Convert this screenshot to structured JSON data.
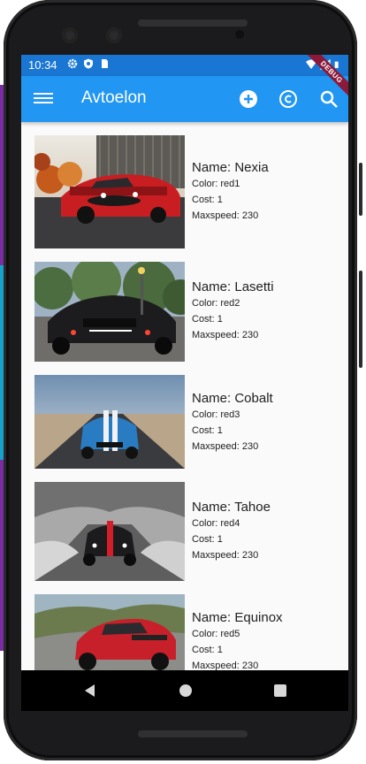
{
  "status_bar": {
    "time": "10:34"
  },
  "app_bar": {
    "title": "Avtoelon",
    "debug_label": "DEBUG",
    "icons": [
      "menu-icon",
      "add-circle-icon",
      "copyright-icon",
      "search-icon"
    ]
  },
  "cars": [
    {
      "name": "Name: Nexia",
      "color": "Color: red1",
      "cost": "Cost: 1",
      "maxspeed": "Maxspeed: 230",
      "image": "red-muscle-car"
    },
    {
      "name": "Name: Lasetti",
      "color": "Color: red2",
      "cost": "Cost: 1",
      "maxspeed": "Maxspeed: 230",
      "image": "black-mustang"
    },
    {
      "name": "Name: Cobalt",
      "color": "Color: red3",
      "cost": "Cost: 1",
      "maxspeed": "Maxspeed: 230",
      "image": "blue-shelby"
    },
    {
      "name": "Name: Tahoe",
      "color": "Color: red4",
      "cost": "Cost: 1",
      "maxspeed": "Maxspeed: 230",
      "image": "black-car-on-bridge"
    },
    {
      "name": "Name: Equinox",
      "color": "Color: red5",
      "cost": "Cost: 1",
      "maxspeed": "Maxspeed: 230",
      "image": "red-mustang-coast"
    }
  ],
  "colors": {
    "status_bar": "#1976d2",
    "app_bar": "#2196f3",
    "debug_banner": "#8b1a3a"
  }
}
